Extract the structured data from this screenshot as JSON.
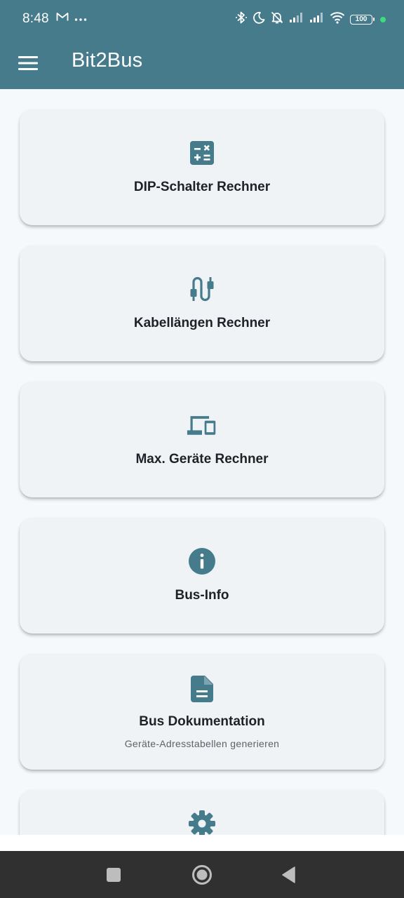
{
  "status_bar": {
    "time": "8:48",
    "battery": "100",
    "left_icons": [
      "gmail-icon",
      "more-dots-icon"
    ],
    "right_icons": [
      "bluetooth-icon",
      "moon-icon",
      "bell-off-icon",
      "signal-icon",
      "signal-icon",
      "wifi-icon",
      "battery-icon"
    ]
  },
  "app_bar": {
    "title": "Bit2Bus",
    "menu_icon": "menu-icon"
  },
  "cards": [
    {
      "label": "DIP-Schalter Rechner",
      "icon": "calculator-icon"
    },
    {
      "label": "Kabellängen Rechner",
      "icon": "cable-icon"
    },
    {
      "label": "Max. Geräte Rechner",
      "icon": "devices-icon"
    },
    {
      "label": "Bus-Info",
      "icon": "info-icon"
    },
    {
      "label": "Bus Dokumentation",
      "sublabel": "Geräte-Adresstabellen generieren",
      "icon": "document-icon"
    },
    {
      "icon": "settings-icon"
    }
  ],
  "colors": {
    "primary": "#467b8c",
    "background": "#f5f9fc",
    "card": "#eff3f6",
    "text": "#1c2227",
    "nav_bar": "#303030"
  },
  "nav_bar": {
    "buttons": [
      "recent-apps-icon",
      "home-icon",
      "back-icon"
    ]
  }
}
